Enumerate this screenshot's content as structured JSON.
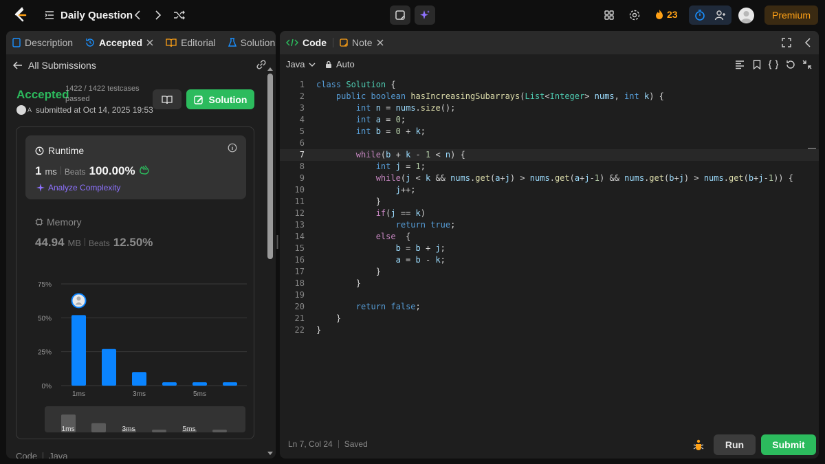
{
  "header": {
    "title": "Daily Question",
    "streak": "23",
    "premium": "Premium"
  },
  "left_tabs": [
    {
      "label": "Description"
    },
    {
      "label": "Accepted"
    },
    {
      "label": "Editorial"
    },
    {
      "label": "Solutions"
    }
  ],
  "submission": {
    "back_label": "All Submissions",
    "status": "Accepted",
    "testcases": "1422 / 1422 testcases passed",
    "submitted_prefix": "submitted at Oct 14, 2025 19:53",
    "solution_label": "Solution",
    "user_initial": "A"
  },
  "runtime": {
    "title": "Runtime",
    "value": "1",
    "unit": "ms",
    "beats_label": "Beats",
    "beats_value": "100.00%",
    "analyze": "Analyze Complexity"
  },
  "memory": {
    "title": "Memory",
    "value": "44.94",
    "unit": "MB",
    "beats_label": "Beats",
    "beats_value": "12.50%"
  },
  "chart_data": {
    "type": "bar",
    "categories": [
      "1ms",
      "2ms",
      "3ms",
      "4ms",
      "5ms",
      "6ms"
    ],
    "values": [
      52,
      27,
      10,
      2.5,
      2.5,
      2.5
    ],
    "xtick_labels": [
      "1ms",
      "",
      "3ms",
      "",
      "5ms",
      ""
    ],
    "ytick_labels": [
      "0%",
      "25%",
      "50%",
      "75%"
    ],
    "yticks": [
      0,
      25,
      50,
      75
    ],
    "ylim": [
      0,
      75
    ],
    "highlight_category": "1ms",
    "bar_color": "#0a84ff",
    "mini_chart_labels": [
      "1ms",
      "3ms",
      "5ms"
    ]
  },
  "left_footer": {
    "code_label": "Code",
    "lang": "Java"
  },
  "right_tabs": [
    {
      "label": "Code"
    },
    {
      "label": "Note"
    }
  ],
  "editor": {
    "language": "Java",
    "mode": "Auto",
    "status_position": "Ln 7, Col 24",
    "status_saved": "Saved",
    "run_label": "Run",
    "submit_label": "Submit",
    "current_line": 7,
    "lines": [
      "class Solution {",
      "    public boolean hasIncreasingSubarrays(List<Integer> nums, int k) {",
      "        int n = nums.size();",
      "        int a = 0;",
      "        int b = 0 + k;",
      "",
      "        while(b + k - 1 < n) {",
      "            int j = 1;",
      "            while(j < k && nums.get(a+j) > nums.get(a+j-1) && nums.get(b+j) > nums.get(b+j-1)) {",
      "                j++;",
      "            }",
      "            if(j == k)",
      "                return true;",
      "            else  {",
      "                b = b + j;",
      "                a = b - k;",
      "            }",
      "        }",
      "",
      "        return false;",
      "    }",
      "}"
    ]
  }
}
